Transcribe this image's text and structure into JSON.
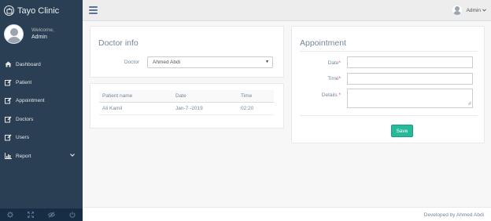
{
  "app": {
    "title": "Tayo Clinic"
  },
  "profile": {
    "welcome": "Welcome,",
    "name": "Admin"
  },
  "sidebar": {
    "items": [
      {
        "label": "Dashboard",
        "icon": "home-icon"
      },
      {
        "label": "Patient",
        "icon": "edit-icon"
      },
      {
        "label": "Appointment",
        "icon": "edit-icon"
      },
      {
        "label": "Doctors",
        "icon": "edit-icon"
      },
      {
        "label": "Users",
        "icon": "edit-icon"
      },
      {
        "label": "Report",
        "icon": "bar-chart-icon"
      }
    ],
    "footer_icons": [
      "settings-icon",
      "fullscreen-icon",
      "lock-icon",
      "power-icon"
    ]
  },
  "topnav": {
    "user": "Admin"
  },
  "doctor_info": {
    "title": "Doctor info",
    "doctor_label": "Doctor",
    "doctor_value": "Ahmed Abdi"
  },
  "appointments_table": {
    "headers": [
      "Patient name",
      "Date",
      "Time"
    ],
    "rows": [
      [
        "Ali Kamil",
        "Jan-7 -2019",
        "02:20"
      ]
    ]
  },
  "appointment_form": {
    "title": "Appointment",
    "date_label": "Date",
    "time_label": "Time",
    "details_label": "Details",
    "required_mark": "*",
    "save_label": "Save"
  },
  "footer": {
    "text": "Developed by Ahmed Abdi"
  },
  "colors": {
    "sidebar_bg": "#2a3f54",
    "accent_green": "#26b99a",
    "required_red": "#e74c3c"
  }
}
